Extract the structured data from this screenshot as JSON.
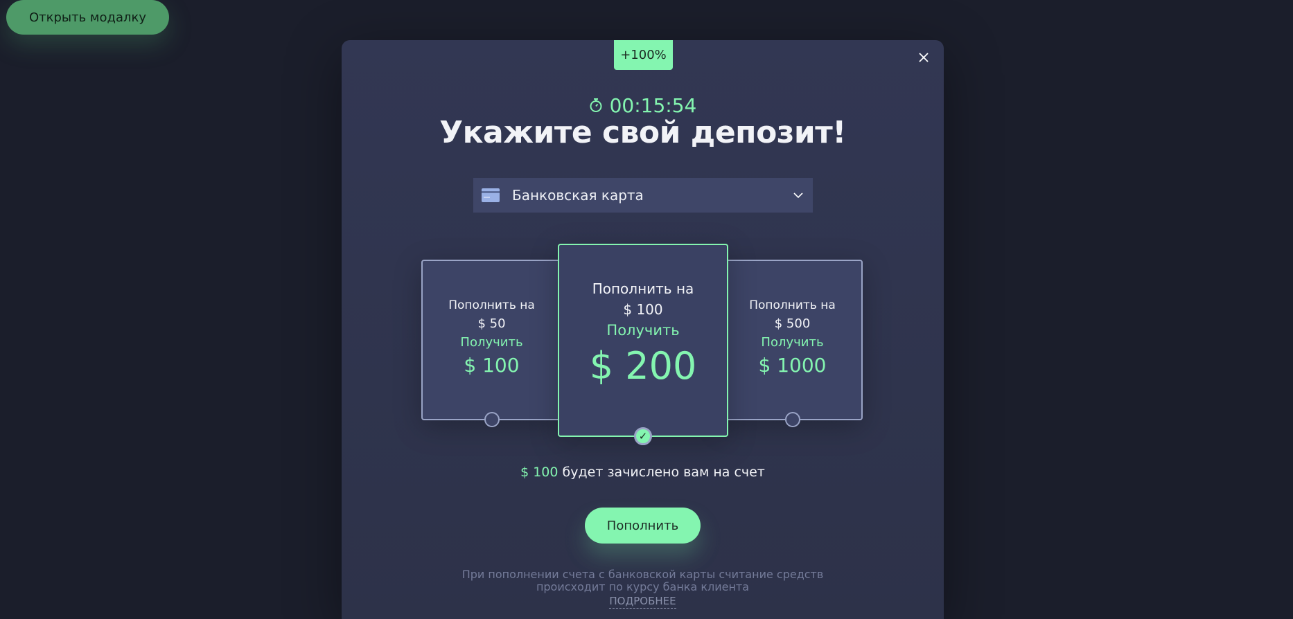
{
  "page": {
    "open_button_label": "Открыть модалку"
  },
  "modal": {
    "badge": "+100%",
    "timer": "00:15:54",
    "title": "Укажите свой депозит!",
    "payment_method": {
      "selected": "Банковская карта",
      "icon": "bank-card-icon"
    },
    "cards": [
      {
        "line1": "Пополнить на",
        "deposit": "$ 50",
        "get_label": "Получить",
        "bonus": "$ 100",
        "selected": false
      },
      {
        "line1": "Пополнить на",
        "deposit": "$ 100",
        "get_label": "Получить",
        "bonus": "$ 200",
        "selected": true
      },
      {
        "line1": "Пополнить на",
        "deposit": "$ 500",
        "get_label": "Получить",
        "bonus": "$ 1000",
        "selected": false
      }
    ],
    "summary": {
      "amount": "$ 100",
      "text": "будет зачислено вам на счет"
    },
    "submit_label": "Пополнить",
    "note_line1": "При пополнении счета с банковской карты считание средств",
    "note_line2": "происходит по курсу банка клиента",
    "more_label": "ПОДРОБНЕЕ"
  },
  "colors": {
    "background": "#1b1e2b",
    "modal": "#323753",
    "accent": "#84f5b0",
    "open_button": "#4e9a68"
  }
}
